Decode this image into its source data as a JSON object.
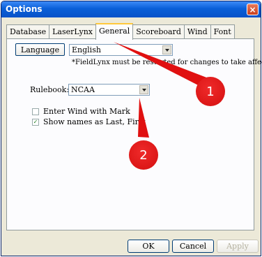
{
  "window": {
    "title": "Options",
    "close": "×"
  },
  "tabs": [
    "Database",
    "LaserLynx",
    "General",
    "Scoreboard",
    "Wind",
    "Font"
  ],
  "general": {
    "language_button": "Language",
    "language_value": "English",
    "note": "*FieldLynx must be restarted for changes to take affect.",
    "rulebook_label": "Rulebook:",
    "rulebook_value": "NCAA",
    "checkboxes": [
      {
        "label": "Enter Wind with Mark",
        "checked": false
      },
      {
        "label": "Show names as Last, First",
        "checked": true
      }
    ]
  },
  "buttons": {
    "ok": "OK",
    "cancel": "Cancel",
    "apply": "Apply"
  },
  "callouts": [
    "1",
    "2"
  ],
  "colors": {
    "titlebar": "#0a5fd8",
    "callout": "#e01010",
    "active_tab_accent": "#ffc83c"
  }
}
